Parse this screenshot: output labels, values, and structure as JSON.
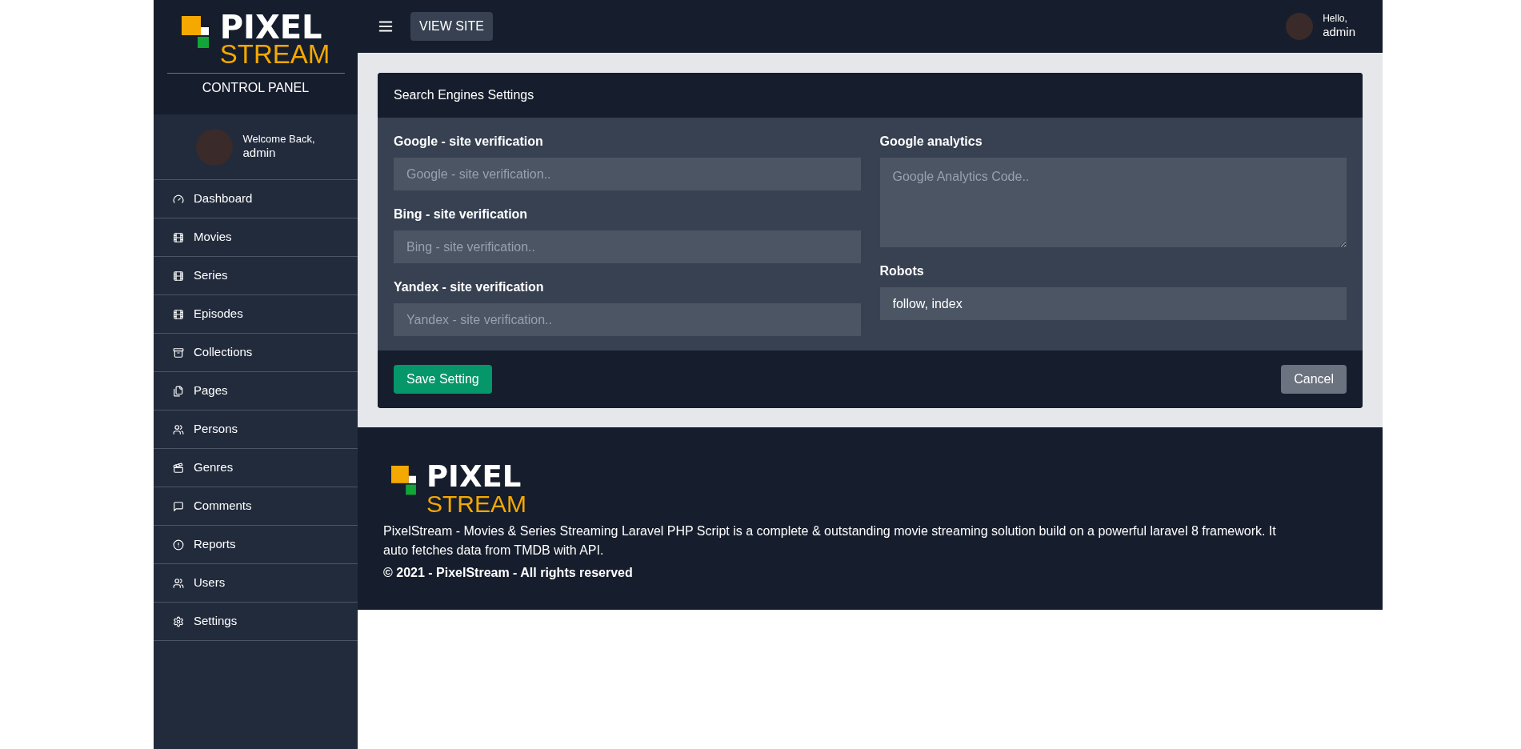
{
  "sidebar": {
    "logo": {
      "line1": "PIXEL",
      "line2": "STREAM"
    },
    "subtitle": "CONTROL PANEL",
    "welcome": "Welcome Back,",
    "username": "admin",
    "items": [
      {
        "label": "Dashboard",
        "selected": false
      },
      {
        "label": "Movies",
        "selected": false
      },
      {
        "label": "Series",
        "selected": false
      },
      {
        "label": "Episodes",
        "selected": false
      },
      {
        "label": "Collections",
        "selected": false
      },
      {
        "label": "Pages",
        "selected": false
      },
      {
        "label": "Persons",
        "selected": false
      },
      {
        "label": "Genres",
        "selected": false
      },
      {
        "label": "Comments",
        "selected": false
      },
      {
        "label": "Reports",
        "selected": false
      },
      {
        "label": "Users",
        "selected": false
      },
      {
        "label": "Settings",
        "selected": false
      }
    ]
  },
  "topbar": {
    "view_site": "VIEW SITE",
    "greeting": "Hello,",
    "username": "admin"
  },
  "card": {
    "title": "Search Engines Settings",
    "left_fields": [
      {
        "label": "Google - site verification",
        "placeholder": "Google - site verification.."
      },
      {
        "label": "Bing - site verification",
        "placeholder": "Bing - site verification.."
      },
      {
        "label": "Yandex - site verification",
        "placeholder": "Yandex - site verification.."
      }
    ],
    "analytics": {
      "label": "Google analytics",
      "placeholder": "Google Analytics Code.."
    },
    "robots": {
      "label": "Robots",
      "value": "follow, index"
    },
    "save": "Save Setting",
    "cancel": "Cancel"
  },
  "footer": {
    "logo": {
      "line1": "PIXEL",
      "line2": "STREAM"
    },
    "description": "PixelStream - Movies & Series Streaming Laravel PHP Script is a complete & outstanding movie streaming solution build on a powerful laravel 8 framework. It auto fetches data from TMDB with API.",
    "copyright": "© 2021 - PixelStream - All rights reserved"
  }
}
